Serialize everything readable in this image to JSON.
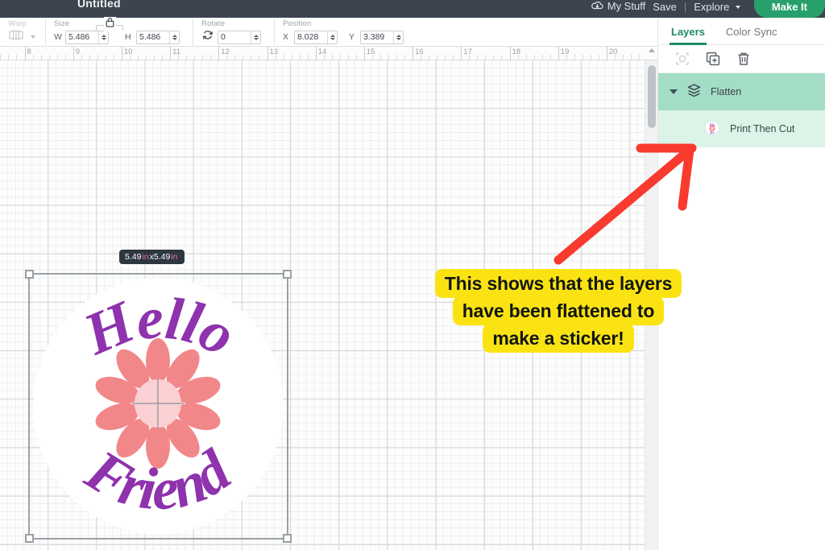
{
  "topbar": {
    "doc_title": "Untitled",
    "my_stuff": "My Stuff",
    "save": "Save",
    "separator": "|",
    "explore": "Explore",
    "make_it": "Make It",
    "cloud_icon": "cloud-icon",
    "caret_icon": "chevron-down-icon"
  },
  "toolbar": {
    "warp": {
      "label": "Warp",
      "icon": "warp-icon"
    },
    "size": {
      "label": "Size",
      "lock_icon": "lock-icon",
      "width_label": "W",
      "width_value": "5.486",
      "height_label": "H",
      "height_value": "5.486"
    },
    "rotate": {
      "label": "Rotate",
      "icon": "rotate-icon",
      "value": "0"
    },
    "position": {
      "label": "Position",
      "x_label": "X",
      "x_value": "8.028",
      "y_label": "Y",
      "y_value": "3.389"
    }
  },
  "canvas": {
    "ruler_labels": [
      "8",
      "9",
      "10",
      "11",
      "12",
      "13",
      "14",
      "15",
      "16",
      "17",
      "18",
      "19",
      "20"
    ],
    "size_badge": {
      "width": "5.49",
      "unit_1": "in",
      "times": "x",
      "height": "5.49",
      "unit_2": "in"
    },
    "artwork": {
      "top_text": "Hello",
      "bottom_text": "Friend",
      "text_color": "#8e32ad",
      "petal_color": "#f2878a",
      "center_color": "#fad0d3",
      "background_color": "#ffffff",
      "flower_icon": "flower-icon"
    }
  },
  "annotation": {
    "arrow_icon": "red-arrow-icon",
    "arrow_color": "#f93a2e",
    "callout_color": "#fbe313",
    "lines": [
      "This shows that the layers",
      "have been flattened to",
      "make a sticker!"
    ]
  },
  "panel": {
    "tabs": [
      {
        "label": "Layers",
        "active": true
      },
      {
        "label": "Color Sync",
        "active": false
      }
    ],
    "tools": [
      {
        "name": "group-icon",
        "disabled": true
      },
      {
        "name": "duplicate-icon",
        "disabled": false
      },
      {
        "name": "delete-icon",
        "disabled": false
      }
    ],
    "layers": [
      {
        "label": "Flatten",
        "icon": "flatten-icon",
        "type": "group"
      },
      {
        "label": "Print Then Cut",
        "icon": "print-then-cut-thumbnail",
        "type": "child"
      }
    ],
    "accent_color": "#1d8a6b",
    "group_row_color": "#a4ddc6",
    "child_row_color": "#dcf3e8"
  }
}
